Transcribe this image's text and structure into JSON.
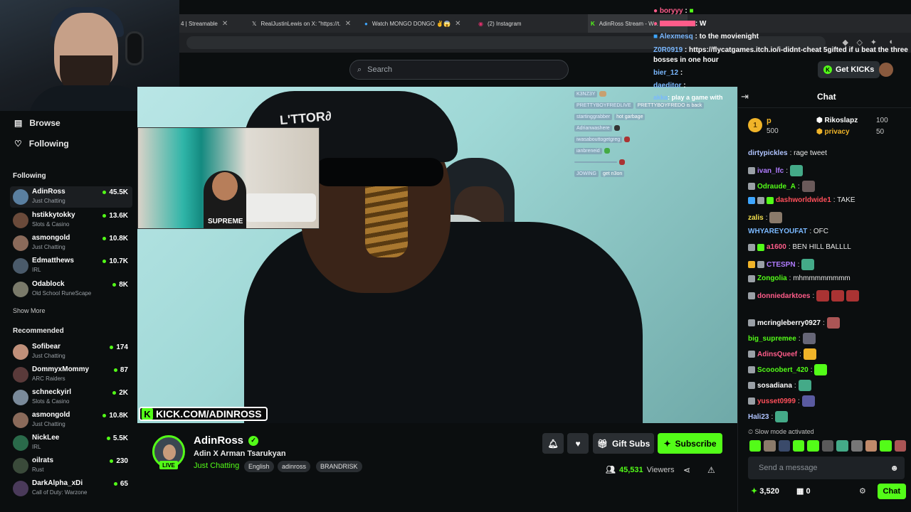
{
  "browser": {
    "tabs": [
      {
        "label": "4 | Streamable",
        "icon": "streamable-icon"
      },
      {
        "label": "RealJustinLewis on X: \"https://t.",
        "icon": "x-icon"
      },
      {
        "label": "Watch MONGO DONGO ✌😱",
        "icon": "video-icon"
      },
      {
        "label": "(2) Instagram",
        "icon": "instagram-icon"
      },
      {
        "label": "AdinRoss Stream - W...",
        "icon": "kick-icon"
      }
    ]
  },
  "top": {
    "search_placeholder": "Search",
    "get_kicks": "Get KICKs"
  },
  "sidebar": {
    "browse": "Browse",
    "following_nav": "Following",
    "following_title": "Following",
    "following": [
      {
        "name": "AdinRoss",
        "category": "Just Chatting",
        "viewers": "45.5K",
        "color": "#5a7fa0"
      },
      {
        "name": "hstikkytokky",
        "category": "Slots & Casino",
        "viewers": "13.6K",
        "color": "#6a4a3a"
      },
      {
        "name": "asmongold",
        "category": "Just Chatting",
        "viewers": "10.8K",
        "color": "#8a6a5a"
      },
      {
        "name": "Edmatthews",
        "category": "IRL",
        "viewers": "10.7K",
        "color": "#4a5a6a"
      },
      {
        "name": "Odablock",
        "category": "Old School RuneScape",
        "viewers": "8K",
        "color": "#7a7a6a"
      }
    ],
    "show_more": "Show More",
    "recommended_title": "Recommended",
    "recommended": [
      {
        "name": "Sofibear",
        "category": "Just Chatting",
        "viewers": "174",
        "color": "#c0907a"
      },
      {
        "name": "DommyxMommy",
        "category": "ARC Raiders",
        "viewers": "87",
        "color": "#5a3a3a"
      },
      {
        "name": "schneckyirl",
        "category": "Slots & Casino",
        "viewers": "2K",
        "color": "#7a8a9a"
      },
      {
        "name": "asmongold",
        "category": "Just Chatting",
        "viewers": "10.8K",
        "color": "#8a6a5a"
      },
      {
        "name": "NickLee",
        "category": "IRL",
        "viewers": "5.5K",
        "color": "#2a6a4a"
      },
      {
        "name": "oilrats",
        "category": "Rust",
        "viewers": "230",
        "color": "#3a4a3a"
      },
      {
        "name": "DarkAlpha_xDi",
        "category": "Call of Duty: Warzone",
        "viewers": "65",
        "color": "#4a3a5a"
      }
    ]
  },
  "video": {
    "hat_text": "L'TTOR∂",
    "pip_text": "SUPREME",
    "kick_url": "KICK.COM/ADINROSS",
    "kick_logo": "K",
    "overlay_chat": [
      {
        "name": "K3NZ3Y",
        "msg": ""
      },
      {
        "name": "PRETTYBOYFREDLIVE",
        "msg": "PRETTYBOYFREDO is back"
      },
      {
        "name": "startinggrabber",
        "msg": "hot garbage"
      },
      {
        "name": "Adrianwashere",
        "msg": ""
      },
      {
        "name": "iwasabouttogetgreg",
        "msg": ""
      },
      {
        "name": "ianbreneid",
        "msg": ""
      },
      {
        "name": "",
        "msg": ""
      },
      {
        "name": "JOWING",
        "msg": "get n3on"
      }
    ]
  },
  "stream": {
    "channel": "AdinRoss",
    "live": "LIVE",
    "title": "Adin X Arman Tsarukyan",
    "category": "Just Chatting",
    "tags": [
      "English",
      "adinross",
      "BRANDRISK"
    ],
    "gift_subs": "Gift Subs",
    "subscribe": "Subscribe",
    "viewers": "45,531",
    "viewers_label": "Viewers"
  },
  "overlay_top_chat": [
    {
      "name": "boryyy",
      "msg": ":",
      "color": "#ff5c8a"
    },
    {
      "name": "",
      "msg": ": W",
      "color": "#ff5c8a"
    },
    {
      "name": "Alexmesq",
      "msg": ": to the movienight",
      "color": "#7ab8ff"
    },
    {
      "name": "Z0R0919",
      "msg": ": https://flycatgames.itch.io/i-didnt-cheat 5gifted if u beat the three",
      "color": "#7ab8ff"
    },
    {
      "name": "",
      "msg": "bosses in one hour",
      "color": "#ffffff"
    },
    {
      "name": "bier_12",
      "msg": ":",
      "color": "#7ab8ff"
    },
    {
      "name": "daeditor",
      "msg": ":",
      "color": "#7ab8ff"
    },
    {
      "name": "akka",
      "msg": ": play a game with",
      "color": "#7ab8ff"
    }
  ],
  "chat": {
    "title": "Chat",
    "leaderboard": [
      {
        "rank": "1",
        "name": "p",
        "points": "500"
      },
      {
        "rank": "",
        "name": "Rikoslapz",
        "points": "100"
      },
      {
        "rank": "",
        "name": "privacy",
        "points": "50"
      }
    ],
    "messages": [
      {
        "user": "dirtypickles",
        "color": "#b0c4ff",
        "text": ": rage tweet"
      },
      {
        "user": "ivan_lfc",
        "color": "#b07cff",
        "text": ":"
      },
      {
        "user": "Odraude_A",
        "color": "#53fc18",
        "text": ":"
      },
      {
        "user": "dashworldwide1",
        "color": "#ff4f5a",
        "text": ": TAKE"
      },
      {
        "user": "zalis",
        "color": "#f4e04d",
        "text": ":"
      },
      {
        "user": "WHYAREYOUFAT",
        "color": "#7ab8ff",
        "text": ": OFC"
      },
      {
        "user": "a1600",
        "color": "#ff5c8a",
        "text": ": BEN HILL BALLLL"
      },
      {
        "user": "CTESPN",
        "color": "#b07cff",
        "text": ":"
      },
      {
        "user": "Zongolia",
        "color": "#53fc18",
        "text": ": mhmmmmmmmm"
      },
      {
        "user": "donniedarktoes",
        "color": "#ff5c8a",
        "text": ":"
      },
      {
        "user": "mcringleberry0927",
        "color": "#ffffff",
        "text": ":"
      },
      {
        "user": "big_supremee",
        "color": "#53fc18",
        "text": ":"
      },
      {
        "user": "AdinsQueef",
        "color": "#ff5c8a",
        "text": ":"
      },
      {
        "user": "Scooobert_420",
        "color": "#53fc18",
        "text": ":"
      },
      {
        "user": "sosadiana",
        "color": "#ffffff",
        "text": ":"
      },
      {
        "user": "yusset0999",
        "color": "#ff4f5a",
        "text": ":"
      },
      {
        "user": "Hali23",
        "color": "#b0c4ff",
        "text": ":"
      }
    ],
    "slow_mode": "Slow mode activated",
    "input_placeholder": "Send a message",
    "points": "3,520",
    "drops": "0",
    "send": "Chat"
  }
}
